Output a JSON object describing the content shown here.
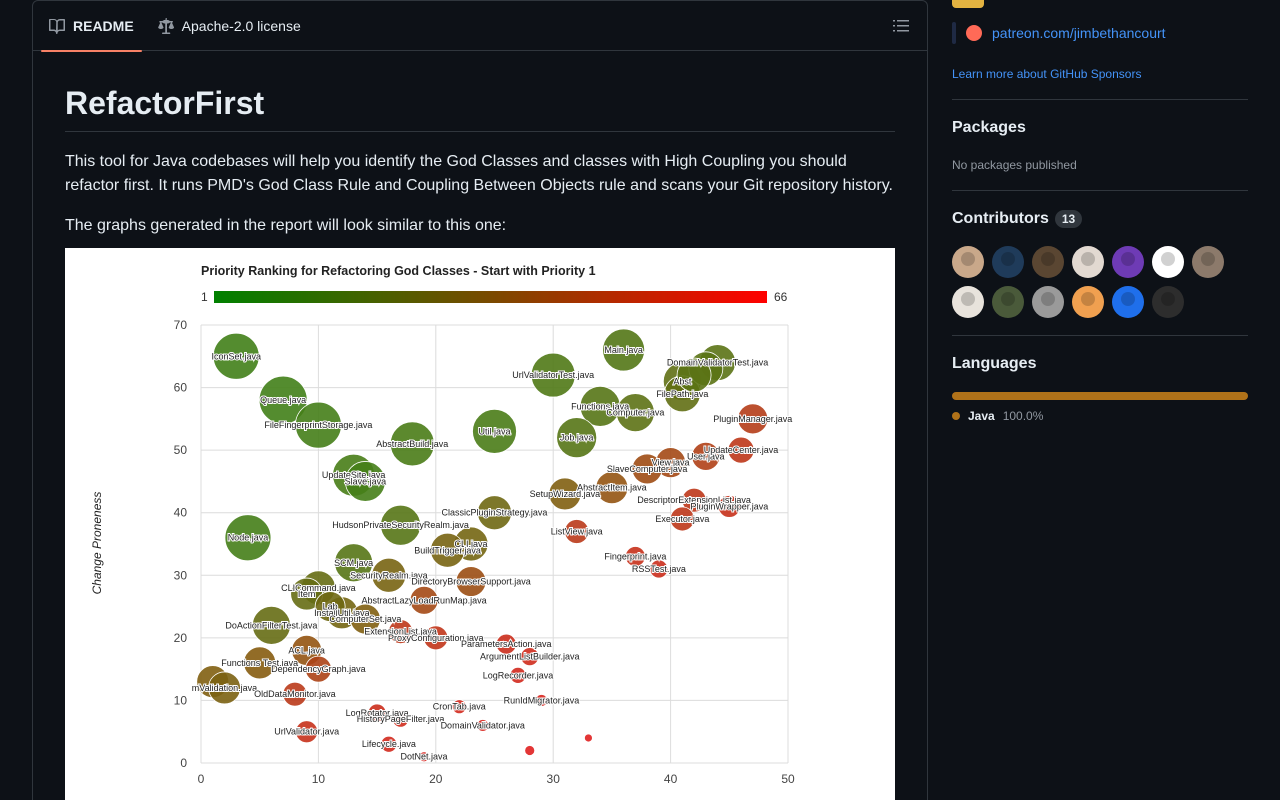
{
  "readme": {
    "tabs": [
      {
        "label": "README",
        "active": true
      },
      {
        "label": "Apache-2.0 license",
        "active": false
      }
    ],
    "title": "RefactorFirst",
    "paragraph1": "This tool for Java codebases will help you identify the God Classes and classes with High Coupling you should refactor first. It runs PMD's God Class Rule and Coupling Between Objects rule and scans your Git repository history.",
    "paragraph2": "The graphs generated in the report will look similar to this one:"
  },
  "chart_data": {
    "type": "scatter",
    "title": "Priority Ranking for Refactoring God Classes - Start with Priority 1",
    "ylabel": "Change Proneness",
    "xlabel": "",
    "xlim": [
      0,
      50
    ],
    "ylim": [
      0,
      70
    ],
    "xticks": [
      "0",
      "10",
      "20",
      "30",
      "40",
      "50"
    ],
    "yticks": [
      "0",
      "10",
      "20",
      "30",
      "40",
      "50",
      "60",
      "70"
    ],
    "colorbar": {
      "min": "1",
      "max": "66",
      "low_color": "#008000",
      "high_color": "#ff0000"
    },
    "points": [
      {
        "label": "IconSet.java",
        "x": 3,
        "y": 65,
        "r": 23,
        "c": 0.1
      },
      {
        "label": "Queue.java",
        "x": 7,
        "y": 58,
        "r": 24,
        "c": 0.1
      },
      {
        "label": "FileFingerprintStorage.java",
        "x": 10,
        "y": 54,
        "r": 23,
        "c": 0.12
      },
      {
        "label": "AbstractBuild.java",
        "x": 18,
        "y": 51,
        "r": 22,
        "c": 0.15
      },
      {
        "label": "Util.java",
        "x": 25,
        "y": 53,
        "r": 22,
        "c": 0.15
      },
      {
        "label": "UrlValidatorTest.java",
        "x": 30,
        "y": 62,
        "r": 22,
        "c": 0.18
      },
      {
        "label": "Main.java",
        "x": 36,
        "y": 66,
        "r": 21,
        "c": 0.2
      },
      {
        "label": "Functions.java",
        "x": 34,
        "y": 57,
        "r": 20,
        "c": 0.22
      },
      {
        "label": "Computer.java",
        "x": 37,
        "y": 56,
        "r": 19,
        "c": 0.25
      },
      {
        "label": "Job.java",
        "x": 32,
        "y": 52,
        "r": 20,
        "c": 0.22
      },
      {
        "label": "Abst",
        "x": 41,
        "y": 61,
        "r": 19,
        "c": 0.27
      },
      {
        "label": "FilePath.java",
        "x": 41,
        "y": 59,
        "r": 18,
        "c": 0.28
      },
      {
        "label": "DomainValidatorTest.java",
        "x": 44,
        "y": 64,
        "r": 18,
        "c": 0.24
      },
      {
        "label": "",
        "x": 43,
        "y": 63,
        "r": 17,
        "c": 0.24
      },
      {
        "label": "",
        "x": 42,
        "y": 62,
        "r": 17,
        "c": 0.24
      },
      {
        "label": "PluginManager.java",
        "x": 47,
        "y": 55,
        "r": 15,
        "c": 0.75
      },
      {
        "label": "UpdateCenter.java",
        "x": 46,
        "y": 50,
        "r": 13,
        "c": 0.8
      },
      {
        "label": "User.java",
        "x": 43,
        "y": 49,
        "r": 14,
        "c": 0.72
      },
      {
        "label": "View.java",
        "x": 40,
        "y": 48,
        "r": 15,
        "c": 0.65
      },
      {
        "label": "SlaveComputer.java",
        "x": 38,
        "y": 47,
        "r": 15,
        "c": 0.62
      },
      {
        "label": "AbstractItem.java",
        "x": 35,
        "y": 44,
        "r": 16,
        "c": 0.55
      },
      {
        "label": "SetupWizard.java",
        "x": 31,
        "y": 43,
        "r": 16,
        "c": 0.45
      },
      {
        "label": "DescriptorExtensionList.java",
        "x": 42,
        "y": 42,
        "r": 12,
        "c": 0.8
      },
      {
        "label": "PluginWrapper.java",
        "x": 45,
        "y": 41,
        "r": 11,
        "c": 0.85
      },
      {
        "label": "Executor.java",
        "x": 41,
        "y": 39,
        "r": 12,
        "c": 0.8
      },
      {
        "label": "ListView.java",
        "x": 32,
        "y": 37,
        "r": 12,
        "c": 0.78
      },
      {
        "label": "Fingerprint.java",
        "x": 37,
        "y": 33,
        "r": 10,
        "c": 0.85
      },
      {
        "label": "RSSTest.java",
        "x": 39,
        "y": 31,
        "r": 9,
        "c": 0.88
      },
      {
        "label": "UpdateSite.java",
        "x": 13,
        "y": 46,
        "r": 21,
        "c": 0.14
      },
      {
        "label": "Slave.java",
        "x": 14,
        "y": 45,
        "r": 20,
        "c": 0.12
      },
      {
        "label": "ClassicPluginStrategy.java",
        "x": 25,
        "y": 40,
        "r": 17,
        "c": 0.35
      },
      {
        "label": "HudsonPrivateSecurityRealm.java",
        "x": 17,
        "y": 38,
        "r": 20,
        "c": 0.22
      },
      {
        "label": "Node.java",
        "x": 4,
        "y": 36,
        "r": 23,
        "c": 0.12
      },
      {
        "label": "CLI.java",
        "x": 23,
        "y": 35,
        "r": 17,
        "c": 0.38
      },
      {
        "label": "BuildTrigger.java",
        "x": 21,
        "y": 34,
        "r": 17,
        "c": 0.4
      },
      {
        "label": "SCM.java",
        "x": 13,
        "y": 32,
        "r": 19,
        "c": 0.22
      },
      {
        "label": "SecurityRealm.java",
        "x": 16,
        "y": 30,
        "r": 17,
        "c": 0.4
      },
      {
        "label": "DirectoryBrowserSupport.java",
        "x": 23,
        "y": 29,
        "r": 15,
        "c": 0.6
      },
      {
        "label": "CLICommand.java",
        "x": 10,
        "y": 28,
        "r": 17,
        "c": 0.3
      },
      {
        "label": "Item",
        "x": 9,
        "y": 27,
        "r": 16,
        "c": 0.3
      },
      {
        "label": "AbstractLazyLoadRunMap.java",
        "x": 19,
        "y": 26,
        "r": 14,
        "c": 0.65
      },
      {
        "label": "Lab",
        "x": 11,
        "y": 25,
        "r": 15,
        "c": 0.35
      },
      {
        "label": "InstallUtil.java",
        "x": 12,
        "y": 24,
        "r": 16,
        "c": 0.38
      },
      {
        "label": "ComputerSet.java",
        "x": 14,
        "y": 23,
        "r": 15,
        "c": 0.45
      },
      {
        "label": "DoActionFilterTest.java",
        "x": 6,
        "y": 22,
        "r": 19,
        "c": 0.3
      },
      {
        "label": "ExtensionList.java",
        "x": 17,
        "y": 21,
        "r": 12,
        "c": 0.8
      },
      {
        "label": "ProxyConfiguration.java",
        "x": 20,
        "y": 20,
        "r": 12,
        "c": 0.82
      },
      {
        "label": "ParametersAction.java",
        "x": 26,
        "y": 19,
        "r": 10,
        "c": 0.88
      },
      {
        "label": "ACL.java",
        "x": 9,
        "y": 18,
        "r": 15,
        "c": 0.55
      },
      {
        "label": "ArgumentListBuilder.java",
        "x": 28,
        "y": 17,
        "r": 9,
        "c": 0.9
      },
      {
        "label": "Functions Test.java",
        "x": 5,
        "y": 16,
        "r": 16,
        "c": 0.48
      },
      {
        "label": "DependencyGraph.java",
        "x": 10,
        "y": 15,
        "r": 13,
        "c": 0.7
      },
      {
        "label": "LogRecorder.java",
        "x": 27,
        "y": 14,
        "r": 8,
        "c": 0.92
      },
      {
        "label": "",
        "x": 1,
        "y": 13,
        "r": 16,
        "c": 0.45
      },
      {
        "label": "mValidation.java",
        "x": 2,
        "y": 12,
        "r": 16,
        "c": 0.42
      },
      {
        "label": "OldDataMonitor.java",
        "x": 8,
        "y": 11,
        "r": 12,
        "c": 0.78
      },
      {
        "label": "RunIdMigrator.java",
        "x": 29,
        "y": 10,
        "r": 6,
        "c": 0.95
      },
      {
        "label": "CronTab.java",
        "x": 22,
        "y": 9,
        "r": 7,
        "c": 0.92
      },
      {
        "label": "LogRotator.java",
        "x": 15,
        "y": 8,
        "r": 9,
        "c": 0.88
      },
      {
        "label": "HistoryPageFilter.java",
        "x": 17,
        "y": 7,
        "r": 8,
        "c": 0.9
      },
      {
        "label": "DomainValidator.java",
        "x": 24,
        "y": 6,
        "r": 6,
        "c": 0.95
      },
      {
        "label": "UrlValidator.java",
        "x": 9,
        "y": 5,
        "r": 11,
        "c": 0.85
      },
      {
        "label": "Lifecycle.java",
        "x": 16,
        "y": 3,
        "r": 8,
        "c": 0.92
      },
      {
        "label": "",
        "x": 33,
        "y": 4,
        "r": 4,
        "c": 1.0
      },
      {
        "label": "",
        "x": 28,
        "y": 2,
        "r": 5,
        "c": 1.0
      },
      {
        "label": "DotNet.java",
        "x": 19,
        "y": 1,
        "r": 5,
        "c": 0.96
      }
    ]
  },
  "sidebar": {
    "sponsor_link": "patreon.com/jimbethancourt",
    "learn_more": "Learn more about GitHub Sponsors",
    "packages_title": "Packages",
    "packages_empty": "No packages published",
    "contributors_title": "Contributors",
    "contributors_count": "13",
    "avatars": [
      {
        "name": "avatar-1",
        "color": "#c9a88a"
      },
      {
        "name": "avatar-2",
        "color": "#1f3b5a"
      },
      {
        "name": "avatar-3",
        "color": "#5a4632"
      },
      {
        "name": "avatar-4",
        "color": "#e2d9d1"
      },
      {
        "name": "avatar-5",
        "color": "#6e3bb5"
      },
      {
        "name": "avatar-6",
        "color": "#ffffff"
      },
      {
        "name": "avatar-7",
        "color": "#8c7a6b"
      },
      {
        "name": "avatar-8",
        "color": "#e8e3dc"
      },
      {
        "name": "avatar-9",
        "color": "#4a5a3a"
      },
      {
        "name": "avatar-10",
        "color": "#9a9a9a"
      },
      {
        "name": "avatar-11",
        "color": "#f0a050"
      },
      {
        "name": "avatar-12",
        "color": "#1f6feb"
      },
      {
        "name": "avatar-13",
        "color": "#2d2d2d"
      }
    ],
    "languages_title": "Languages",
    "language_name": "Java",
    "language_pct": "100.0%",
    "language_color": "#b07219"
  }
}
